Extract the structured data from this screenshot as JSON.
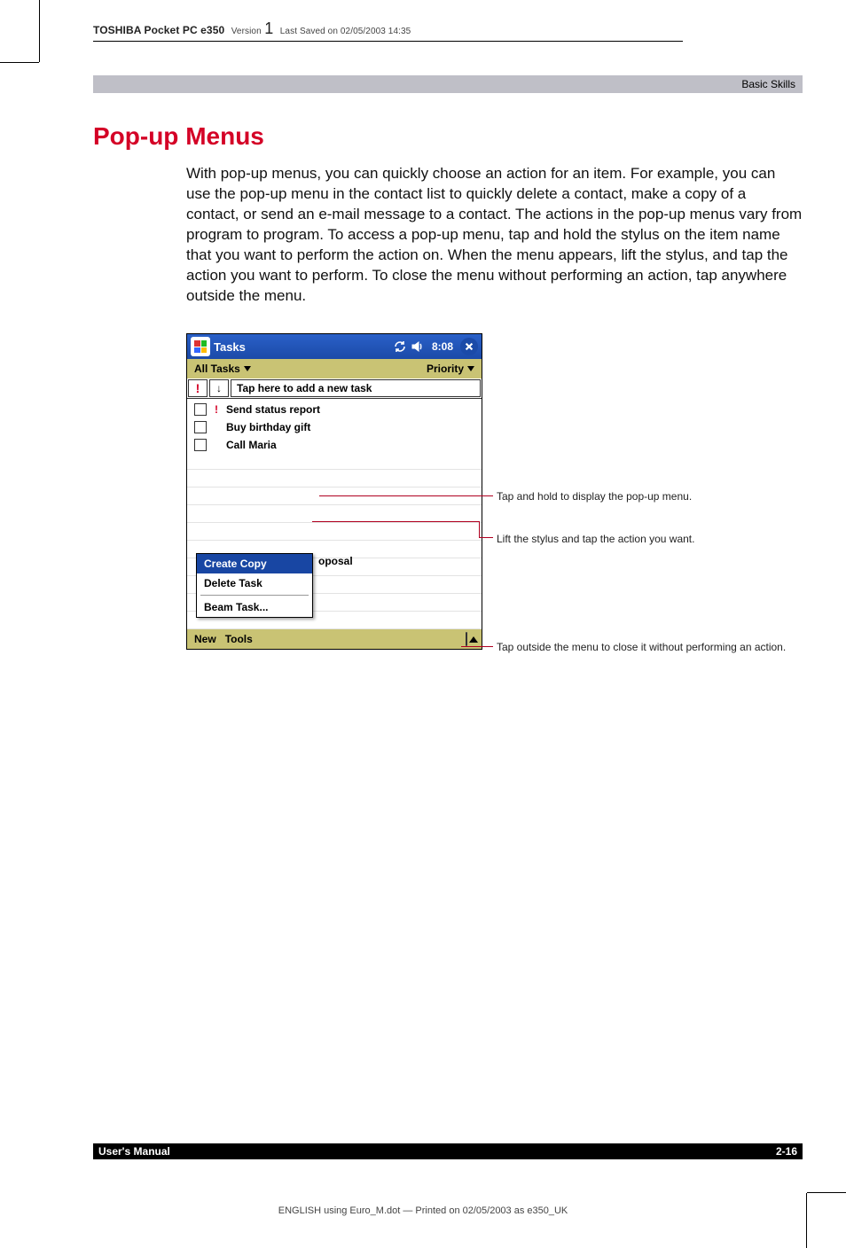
{
  "header": {
    "product": "TOSHIBA Pocket PC e350",
    "version_label": "Version",
    "version_number": "1",
    "last_saved": "Last Saved on 02/05/2003 14:35"
  },
  "section_bar": "Basic Skills",
  "heading": "Pop-up Menus",
  "body": "With pop-up menus, you can quickly choose an action for an item. For example, you can use the pop-up menu in the contact list to quickly delete a contact, make a copy of a contact, or send an e-mail message to a contact. The actions in the pop-up menus vary from program to program. To access a pop-up menu, tap and hold the stylus on the item name that you want to perform the action on. When the menu appears, lift the stylus, and tap the action you want to perform. To close the menu without performing an action, tap anywhere outside the menu.",
  "screenshot": {
    "titlebar": {
      "title": "Tasks",
      "time": "8:08"
    },
    "filter": {
      "left": "All Tasks",
      "right": "Priority"
    },
    "add_row_prompt": "Tap here to add a new task",
    "tasks": [
      {
        "priority": true,
        "label": "Send status report"
      },
      {
        "priority": false,
        "label": "Buy birthday gift"
      },
      {
        "priority": false,
        "label": "Call Maria"
      }
    ],
    "cut_label_fragment": "oposal",
    "popup": {
      "items": [
        {
          "label": "Create Copy",
          "selected": true
        },
        {
          "label": "Delete Task",
          "selected": false
        }
      ],
      "after_divider": "Beam Task..."
    },
    "footer": {
      "new": "New",
      "tools": "Tools"
    }
  },
  "callouts": {
    "c1": "Tap and hold to display the pop-up menu.",
    "c2": "Lift the stylus and tap the action you want.",
    "c3": "Tap outside the menu to close it without performing an action."
  },
  "footer": {
    "left": "User's Manual",
    "right": "2-16"
  },
  "print_note": "ENGLISH using Euro_M.dot — Printed on 02/05/2003 as e350_UK"
}
